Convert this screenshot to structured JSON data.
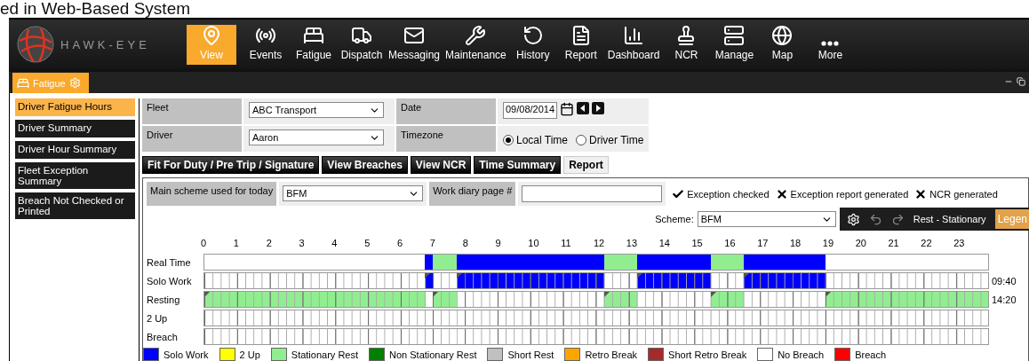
{
  "slide_title": "ed in Web-Based System",
  "logo": {
    "text": "HAWK-EYE"
  },
  "nav": [
    {
      "label": "View",
      "kind": "pin",
      "selected": true
    },
    {
      "label": "Events",
      "kind": "signal",
      "selected": false
    },
    {
      "label": "Fatigue",
      "kind": "bed",
      "selected": false
    },
    {
      "label": "Dispatch",
      "kind": "truck",
      "selected": false
    },
    {
      "label": "Messaging",
      "kind": "mail",
      "selected": false
    },
    {
      "label": "Maintenance",
      "kind": "wrench",
      "selected": false
    },
    {
      "label": "History",
      "kind": "history",
      "selected": false
    },
    {
      "label": "Report",
      "kind": "report",
      "selected": false
    },
    {
      "label": "Dashboard",
      "kind": "dashboard",
      "selected": false
    },
    {
      "label": "NCR",
      "kind": "stamp",
      "selected": false
    },
    {
      "label": "Manage",
      "kind": "manage",
      "selected": false
    },
    {
      "label": "Map",
      "kind": "globe",
      "selected": false
    },
    {
      "label": "More",
      "kind": "more",
      "selected": false
    }
  ],
  "workspace_tab": {
    "label": "Fatigue"
  },
  "sidebar": [
    {
      "label": "Driver Fatigue Hours",
      "selected": true
    },
    {
      "label": "Driver Summary",
      "selected": false
    },
    {
      "label": "Driver Hour Summary",
      "selected": false
    },
    {
      "label": "Fleet Exception Summary",
      "selected": false
    },
    {
      "label": "Breach Not Checked or Printed",
      "selected": false
    }
  ],
  "filters": {
    "fleet": {
      "label": "Fleet",
      "value": "ABC Transport"
    },
    "driver": {
      "label": "Driver",
      "value": "Aaron"
    },
    "date": {
      "label": "Date",
      "value": "09/08/2014"
    },
    "timezone": {
      "label": "Timezone",
      "options": [
        {
          "label": "Local Time",
          "selected": true
        },
        {
          "label": "Driver Time",
          "selected": false
        }
      ]
    }
  },
  "tabs": [
    {
      "label": "Fit For Duty / Pre Trip / Signature",
      "selected": false
    },
    {
      "label": "View Breaches",
      "selected": false
    },
    {
      "label": "View NCR",
      "selected": false
    },
    {
      "label": "Time Summary",
      "selected": false
    },
    {
      "label": "Report",
      "selected": true
    }
  ],
  "scheme_row": {
    "label": "Main scheme used for today",
    "value": "BFM",
    "diary_label": "Work diary page #",
    "statuses": [
      {
        "label": "Exception checked",
        "checked": true
      },
      {
        "label": "Exception report generated",
        "checked": false
      },
      {
        "label": "NCR generated",
        "checked": false
      }
    ]
  },
  "scheme": {
    "label": "Scheme:",
    "value": "BFM"
  },
  "toolbar": {
    "mode": "Rest - Stationary",
    "legend": "Legen"
  },
  "timeline": {
    "rows": [
      {
        "kind": "bar"
      },
      {
        "kind": "grid",
        "total": "09:40"
      },
      {
        "kind": "grid",
        "total": "14:20"
      },
      {
        "kind": "grid"
      },
      {
        "kind": "grid"
      }
    ],
    "chart_data": {
      "type": "bar",
      "orientation": "horizontal",
      "stacked": true,
      "categories": [
        "Real Time",
        "Solo Work",
        "Resting",
        "2 Up",
        "Breach"
      ],
      "xlim": [
        0,
        24
      ],
      "xticks": [
        0,
        1,
        2,
        3,
        4,
        5,
        6,
        7,
        8,
        9,
        10,
        11,
        12,
        13,
        14,
        15,
        16,
        17,
        18,
        19,
        20,
        21,
        22,
        23
      ],
      "series": [
        {
          "color": "#ffffff",
          "values": [
            6.75,
            6.75,
            null,
            6.75,
            6.75
          ]
        },
        {
          "color": "#90ee90",
          "values": [
            null,
            null,
            6.75,
            null,
            null
          ]
        },
        {
          "color": "#0000ff",
          "values": [
            0.25,
            0.25,
            null,
            null,
            null
          ]
        },
        {
          "color": "#ffffff",
          "values": [
            null,
            null,
            0.25,
            0.25,
            0.25
          ]
        },
        {
          "color": "#90ee90",
          "values": [
            0.75,
            null,
            0.75,
            null,
            null
          ]
        },
        {
          "color": "#ffffff",
          "values": [
            null,
            0.75,
            null,
            0.75,
            0.75
          ]
        },
        {
          "color": "#0000ff",
          "values": [
            4.5,
            4.5,
            null,
            null,
            null
          ]
        },
        {
          "color": "#ffffff",
          "values": [
            null,
            null,
            4.5,
            4.5,
            4.5
          ]
        },
        {
          "color": "#90ee90",
          "values": [
            1,
            null,
            1,
            null,
            null
          ]
        },
        {
          "color": "#ffffff",
          "values": [
            null,
            1,
            null,
            1,
            1
          ]
        },
        {
          "color": "#0000ff",
          "values": [
            2.25,
            2.25,
            null,
            null,
            null
          ]
        },
        {
          "color": "#ffffff",
          "values": [
            null,
            null,
            2.25,
            2.25,
            2.25
          ]
        },
        {
          "color": "#90ee90",
          "values": [
            1,
            null,
            1,
            null,
            null
          ]
        },
        {
          "color": "#ffffff",
          "values": [
            null,
            1,
            null,
            1,
            1
          ]
        },
        {
          "color": "#0000ff",
          "values": [
            2.5,
            2.5,
            null,
            null,
            null
          ]
        },
        {
          "color": "#ffffff",
          "values": [
            null,
            null,
            2.5,
            2.5,
            2.5
          ]
        },
        {
          "color": "#ffffff",
          "values": [
            5,
            5,
            null,
            5,
            5
          ]
        },
        {
          "color": "#90ee90",
          "values": [
            null,
            null,
            5,
            null,
            null
          ]
        }
      ]
    }
  },
  "legend": [
    {
      "label": "Solo Work",
      "color": "#0000ff"
    },
    {
      "label": "2 Up",
      "color": "#ffff00"
    },
    {
      "label": "Stationary Rest",
      "color": "#90ee90"
    },
    {
      "label": "Non Stationary Rest",
      "color": "#008000"
    },
    {
      "label": "Short Rest",
      "color": "#c0c0c0"
    },
    {
      "label": "Retro Break",
      "color": "#ffa500"
    },
    {
      "label": "Short Retro Break",
      "color": "#a52a2a"
    },
    {
      "label": "No Breach",
      "color": "#ffffff"
    },
    {
      "label": "Breach",
      "color": "#ff0000"
    }
  ]
}
